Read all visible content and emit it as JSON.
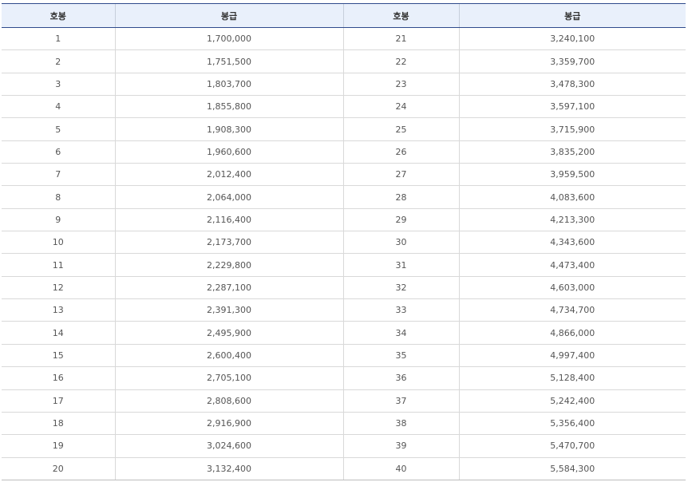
{
  "table": {
    "headers": [
      "호봉",
      "봉급",
      "호봉",
      "봉급"
    ],
    "rows": [
      [
        "1",
        "1,700,000",
        "21",
        "3,240,100"
      ],
      [
        "2",
        "1,751,500",
        "22",
        "3,359,700"
      ],
      [
        "3",
        "1,803,700",
        "23",
        "3,478,300"
      ],
      [
        "4",
        "1,855,800",
        "24",
        "3,597,100"
      ],
      [
        "5",
        "1,908,300",
        "25",
        "3,715,900"
      ],
      [
        "6",
        "1,960,600",
        "26",
        "3,835,200"
      ],
      [
        "7",
        "2,012,400",
        "27",
        "3,959,500"
      ],
      [
        "8",
        "2,064,000",
        "28",
        "4,083,600"
      ],
      [
        "9",
        "2,116,400",
        "29",
        "4,213,300"
      ],
      [
        "10",
        "2,173,700",
        "30",
        "4,343,600"
      ],
      [
        "11",
        "2,229,800",
        "31",
        "4,473,400"
      ],
      [
        "12",
        "2,287,100",
        "32",
        "4,603,000"
      ],
      [
        "13",
        "2,391,300",
        "33",
        "4,734,700"
      ],
      [
        "14",
        "2,495,900",
        "34",
        "4,866,000"
      ],
      [
        "15",
        "2,600,400",
        "35",
        "4,997,400"
      ],
      [
        "16",
        "2,705,100",
        "36",
        "5,128,400"
      ],
      [
        "17",
        "2,808,600",
        "37",
        "5,242,400"
      ],
      [
        "18",
        "2,916,900",
        "38",
        "5,356,400"
      ],
      [
        "19",
        "3,024,600",
        "39",
        "5,470,700"
      ],
      [
        "20",
        "3,132,400",
        "40",
        "5,584,300"
      ]
    ]
  },
  "colors": {
    "header_bg": "#e9f0fb",
    "header_border": "#2f4a8c",
    "row_border": "#d9d9d9",
    "text": "#555555"
  }
}
